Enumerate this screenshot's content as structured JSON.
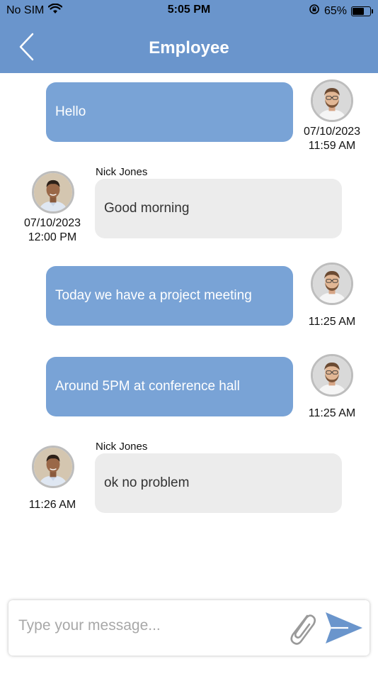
{
  "status_bar": {
    "carrier": "No SIM",
    "time": "5:05 PM",
    "battery": "65%",
    "battery_level": 0.65
  },
  "header": {
    "title": "Employee"
  },
  "messages": [
    {
      "direction": "outgoing",
      "text": "Hello",
      "date": "07/10/2023",
      "time": "11:59 AM"
    },
    {
      "direction": "incoming",
      "sender": "Nick Jones",
      "text": "Good morning",
      "date": "07/10/2023",
      "time": "12:00 PM"
    },
    {
      "direction": "outgoing",
      "text": "Today we have a project meeting",
      "time": "11:25 AM"
    },
    {
      "direction": "outgoing",
      "text": "Around 5PM at conference hall",
      "time": "11:25 AM"
    },
    {
      "direction": "incoming",
      "sender": "Nick Jones",
      "text": "ok no problem",
      "time": "11:26 AM"
    }
  ],
  "composer": {
    "placeholder": "Type your message...",
    "value": ""
  },
  "colors": {
    "header": "#6a95cc",
    "outgoing_bubble": "#79a3d6",
    "incoming_bubble": "#ececec",
    "send_icon": "#6a95cc"
  },
  "icons": {
    "back": "chevron-left-icon",
    "attach": "paperclip-icon",
    "send": "send-icon",
    "wifi": "wifi-icon",
    "orientation_lock": "orientation-lock-icon",
    "battery": "battery-icon"
  }
}
